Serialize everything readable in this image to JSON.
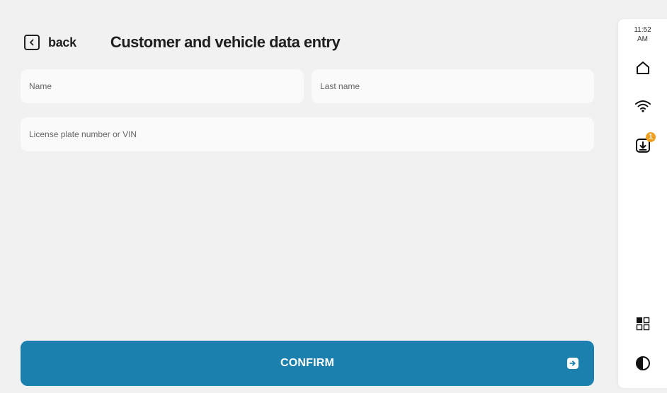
{
  "header": {
    "back_label": "back",
    "title": "Customer and vehicle data entry"
  },
  "form": {
    "name": {
      "placeholder": "Name",
      "value": ""
    },
    "last_name": {
      "placeholder": "Last name",
      "value": ""
    },
    "plate": {
      "placeholder": "License plate number or VIN",
      "value": ""
    }
  },
  "actions": {
    "confirm_label": "CONFIRM"
  },
  "sidebar": {
    "time": "11:52",
    "ampm": "AM",
    "icons": [
      "home-icon",
      "wifi-icon",
      "download-icon",
      "apps-grid-icon",
      "contrast-icon"
    ],
    "download_badge": "1"
  },
  "colors": {
    "accent": "#1b80ad",
    "badge": "#f0a020",
    "background": "#f1f1f1"
  }
}
